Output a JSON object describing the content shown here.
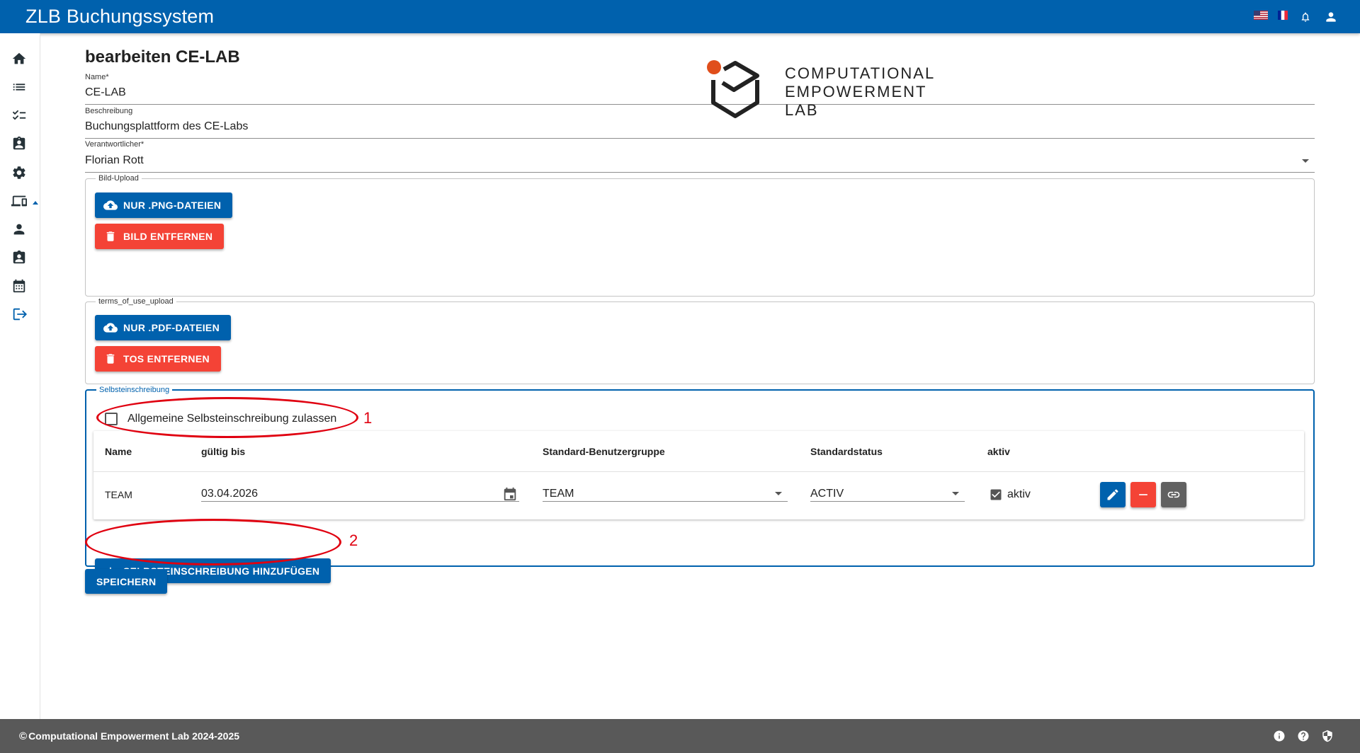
{
  "header": {
    "title": "ZLB Buchungssystem",
    "language_icons": [
      "us-flag-icon",
      "fr-flag-icon"
    ],
    "icons": [
      "bell-icon",
      "account-icon"
    ]
  },
  "sidebar": {
    "items": [
      {
        "icon": "home-icon"
      },
      {
        "icon": "list-icon"
      },
      {
        "icon": "checklist-icon"
      },
      {
        "icon": "clipboard-account-icon"
      },
      {
        "icon": "gear-icon"
      },
      {
        "icon": "devices-icon"
      },
      {
        "icon": "person-icon"
      },
      {
        "icon": "badge-icon"
      },
      {
        "icon": "calendar-icon"
      },
      {
        "icon": "logout-icon"
      }
    ]
  },
  "form": {
    "title": "bearbeiten CE-LAB",
    "name": {
      "label": "Name*",
      "value": "CE-LAB"
    },
    "beschreibung": {
      "label": "Beschreibung",
      "value": "Buchungsplattform des CE-Labs"
    },
    "verantwortlicher": {
      "label": "Verantwortlicher*",
      "value": "Florian Rott"
    },
    "bild_upload": {
      "legend": "Bild-Upload",
      "upload_button": "NUR .PNG-DATEIEN",
      "remove_button": "BILD ENTFERNEN",
      "logo_lines": [
        "COMPUTATIONAL",
        "EMPOWERMENT",
        "LAB"
      ]
    },
    "tos_upload": {
      "legend": "terms_of_use_upload",
      "upload_button": "NUR .PDF-DATEIEN",
      "remove_button": "TOS ENTFERNEN"
    },
    "selbsteinschreibung": {
      "legend": "Selbsteinschreibung",
      "checkbox_label": "Allgemeine Selbsteinschreibung zulassen",
      "checkbox_checked": false,
      "columns": [
        "Name",
        "gültig bis",
        "Standard-Benutzergruppe",
        "Standardstatus",
        "aktiv"
      ],
      "rows": [
        {
          "name": "TEAM",
          "gueltig_bis": "03.04.2026",
          "gruppe": "TEAM",
          "status": "ACTIV",
          "aktiv_label": "aktiv",
          "aktiv_checked": true
        }
      ],
      "add_button": "SELBSTEINSCHREIBUNG HINZUFÜGEN"
    },
    "save_button": "SPEICHERN"
  },
  "annotations": {
    "marker_1": "1",
    "marker_2": "2",
    "color": "#e00010"
  },
  "footer": {
    "copyright_symbol": "©",
    "text": "Computational Empowerment Lab 2024-2025",
    "icons": [
      "info-icon",
      "help-icon",
      "privacy-shield-icon"
    ]
  },
  "colors": {
    "primary": "#0061ad",
    "danger": "#f44336",
    "neutral": "#616161",
    "footer": "#595959",
    "logo_dot": "#e04e1b"
  }
}
